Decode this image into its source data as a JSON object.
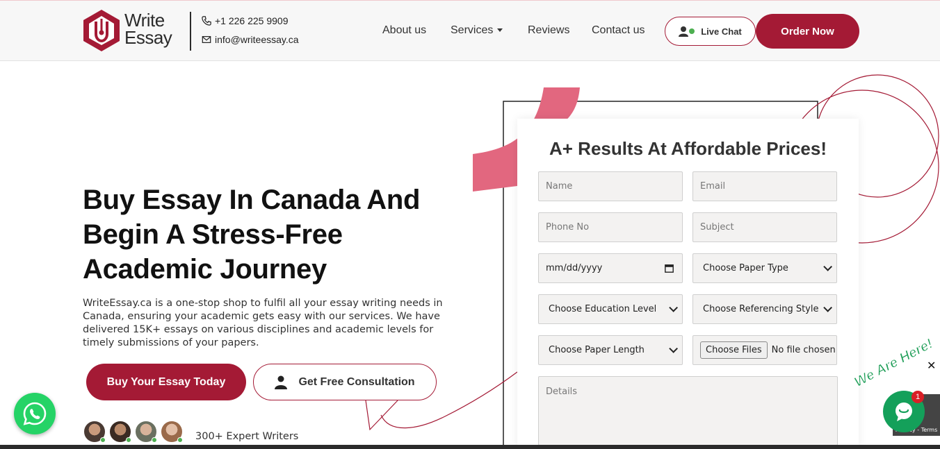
{
  "header": {
    "logo_line1": "Write",
    "logo_line2": "Essay",
    "phone": "+1 226 225 9909",
    "email": "info@writeessay.ca",
    "nav": {
      "about": "About us",
      "services": "Services",
      "reviews": "Reviews",
      "contact": "Contact us"
    },
    "live_chat": "Live Chat",
    "order_now": "Order Now"
  },
  "hero": {
    "title_line1": "Buy Essay In Canada And",
    "title_line2": "Begin A Stress-Free",
    "title_line3": "Academic Journey",
    "description": "WriteEssay.ca is a one-stop shop to fulfil all your essay writing needs in Canada, ensuring your academic gets easy with our services. We have delivered 15K+ essays on various disciplines and academic levels for timely submissions of your papers.",
    "buy_button": "Buy Your Essay Today",
    "consult_button": "Get Free Consultation",
    "experts_text": "300+ Expert Writers"
  },
  "form": {
    "title": "A+ Results At Affordable Prices!",
    "name_placeholder": "Name",
    "email_placeholder": "Email",
    "phone_placeholder": "Phone No",
    "subject_placeholder": "Subject",
    "date_value": "mm/dd/yyyy",
    "paper_type": "Choose Paper Type",
    "education_level": "Choose Education Level",
    "referencing_style": "Choose Referencing Style",
    "paper_length": "Choose Paper Length",
    "files_button": "Choose Files",
    "files_status": "No file chosen",
    "details_placeholder": "Details"
  },
  "widgets": {
    "we_are_here": "We Are Here!",
    "chat_badge": "1",
    "close": "✕",
    "recaptcha": "Privacy - Terms"
  },
  "colors": {
    "brand": "#a41a35",
    "accent_pink": "#e2677f",
    "whatsapp": "#25d366",
    "chat_green": "#14a05a"
  }
}
